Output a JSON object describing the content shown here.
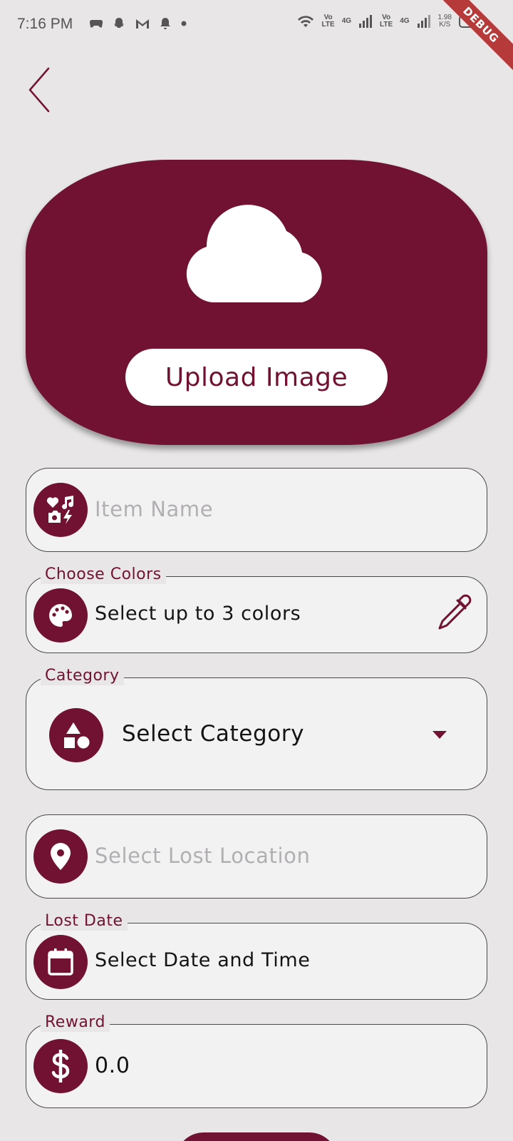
{
  "status_bar": {
    "time": "7:16 PM",
    "net_label_1_top": "Vo",
    "net_label_1_bottom": "LTE",
    "net_4g_1": "4G",
    "net_label_2_top": "Vo",
    "net_label_2_bottom": "LTE",
    "net_4g_2": "4G",
    "speed_value": "1.98",
    "speed_unit": "K/S",
    "debug_banner": "DEBUG"
  },
  "upload": {
    "button_label": "Upload Image"
  },
  "form": {
    "item_name": {
      "placeholder": "Item Name",
      "icon": "item-category-icon"
    },
    "colors": {
      "label": "Choose Colors",
      "value": "Select up to 3 colors",
      "icon": "palette-icon",
      "trailing_icon": "color-picker-icon"
    },
    "category": {
      "label": "Category",
      "value": "Select Category",
      "icon": "shapes-icon",
      "trailing_icon": "dropdown-arrow-icon"
    },
    "location": {
      "placeholder": "Select Lost Location",
      "icon": "location-pin-icon"
    },
    "date": {
      "label": "Lost Date",
      "value": "Select Date and Time",
      "icon": "calendar-icon"
    },
    "reward": {
      "label": "Reward",
      "value": "0.0",
      "icon": "dollar-icon"
    }
  },
  "colors": {
    "primary": "#721233",
    "background": "#e8e6e7",
    "field_fill": "#f3f2f3",
    "placeholder": "#b1afb1",
    "debug": "#b73a3a"
  }
}
